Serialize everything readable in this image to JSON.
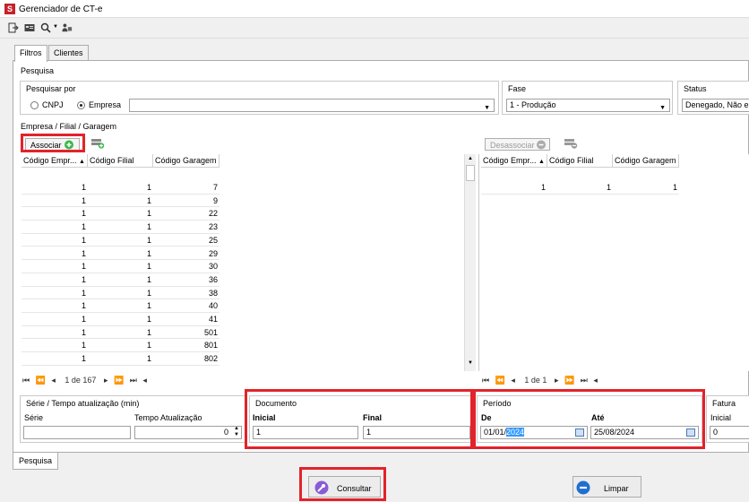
{
  "window": {
    "title": "Gerenciador de CT-e",
    "app_icon": "app-logo"
  },
  "toolbar": {
    "icons": [
      "exit-icon",
      "card-icon",
      "search-icon",
      "users-icon"
    ]
  },
  "tabs": [
    {
      "label": "Filtros",
      "active": true
    },
    {
      "label": "Clientes",
      "active": false
    }
  ],
  "pesquisa": {
    "title": "Pesquisa",
    "pesquisar_por": {
      "title": "Pesquisar por",
      "options": [
        "CNPJ",
        "Empresa"
      ],
      "selected": "Empresa",
      "empresa_value": ""
    },
    "fase": {
      "title": "Fase",
      "value": "1 - Produção"
    },
    "status": {
      "title": "Status",
      "value": "Denegado, Não en"
    }
  },
  "empresa_section": {
    "title": "Empresa / Filial / Garagem"
  },
  "left_grid": {
    "associar_label": "Associar",
    "columns": [
      "Código Empr...",
      "Código Filial",
      "Código Garagem"
    ],
    "rows": [
      [
        "1",
        "1",
        "7"
      ],
      [
        "1",
        "1",
        "9"
      ],
      [
        "1",
        "1",
        "22"
      ],
      [
        "1",
        "1",
        "23"
      ],
      [
        "1",
        "1",
        "25"
      ],
      [
        "1",
        "1",
        "29"
      ],
      [
        "1",
        "1",
        "30"
      ],
      [
        "1",
        "1",
        "36"
      ],
      [
        "1",
        "1",
        "38"
      ],
      [
        "1",
        "1",
        "40"
      ],
      [
        "1",
        "1",
        "41"
      ],
      [
        "1",
        "1",
        "501"
      ],
      [
        "1",
        "1",
        "801"
      ],
      [
        "1",
        "1",
        "802"
      ]
    ],
    "pager_text": "1 de 167"
  },
  "right_grid": {
    "desassociar_label": "Desassociar",
    "columns": [
      "Código Empr...",
      "Código Filial",
      "Código Garagem"
    ],
    "rows": [
      [
        "1",
        "1",
        "1"
      ]
    ],
    "pager_text": "1 de 1"
  },
  "serie": {
    "title": "Série / Tempo atualização (min)",
    "serie_label": "Série",
    "serie_value": "",
    "tempo_label": "Tempo Atualização",
    "tempo_value": "0"
  },
  "documento": {
    "title": "Documento",
    "inicial_label": "Inicial",
    "inicial_value": "1",
    "final_label": "Final",
    "final_value": "1"
  },
  "periodo": {
    "title": "Período",
    "de_label": "De",
    "de_prefix": "01/01/",
    "de_selected": "2024",
    "ate_label": "Até",
    "ate_value": "25/08/2024"
  },
  "fatura": {
    "title": "Fatura",
    "inicial_label": "Inicial",
    "inicial_value": "0"
  },
  "bottom_tab": {
    "label": "Pesquisa"
  },
  "buttons": {
    "consultar": "Consultar",
    "limpar": "Limpar"
  },
  "colors": {
    "highlight": "#e2232a",
    "associar_plus": "#3cb84a",
    "consultar_icon": "#8a5bd6",
    "limpar_icon": "#1f6fd1",
    "selection": "#3399ff"
  }
}
